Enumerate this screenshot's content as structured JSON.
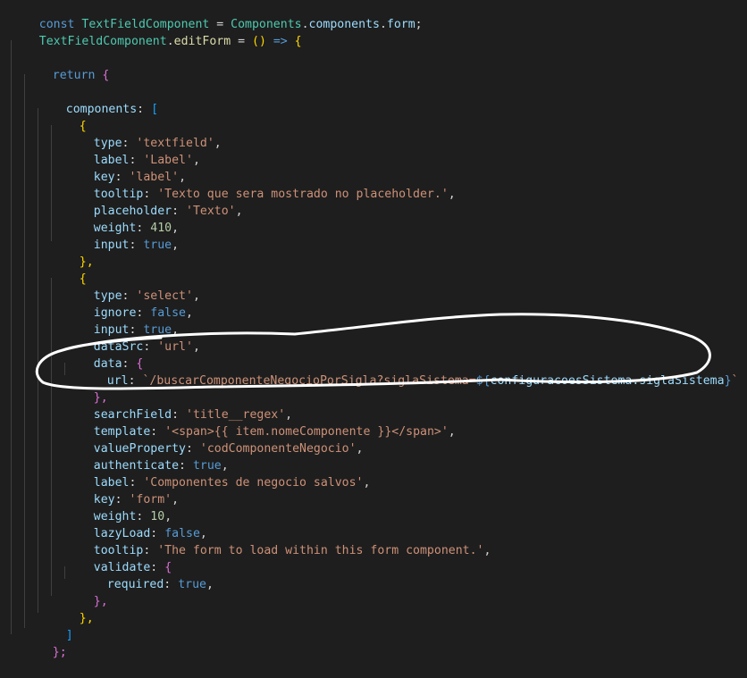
{
  "code": {
    "l1": {
      "kw": "const",
      "name": "TextFieldComponent",
      "eq": " = ",
      "obj": "Components",
      "dot1": ".",
      "p1": "components",
      "dot2": ".",
      "p2": "form",
      "semi": ";"
    },
    "l2": {
      "cls": "TextFieldComponent",
      "dot": ".",
      "fn": "editForm",
      "eq": " = ",
      "paren": "()",
      "arrow": " => ",
      "brace": "{"
    },
    "l4": {
      "kw": "return",
      "brace": "{"
    },
    "l6": {
      "key": "components",
      "colon": ": ",
      "bracket": "["
    },
    "obj_open": "{",
    "obj_close": "},",
    "comma": ",",
    "colon": ": ",
    "textfield": {
      "type_key": "type",
      "type_val": "'textfield'",
      "label_key": "label",
      "label_val": "'Label'",
      "key_key": "key",
      "key_val": "'label'",
      "tooltip_key": "tooltip",
      "tooltip_val": "'Texto que sera mostrado no placeholder.'",
      "placeholder_key": "placeholder",
      "placeholder_val": "'Texto'",
      "weight_key": "weight",
      "weight_val": "410",
      "input_key": "input",
      "input_val": "true"
    },
    "select": {
      "type_key": "type",
      "type_val": "'select'",
      "ignore_key": "ignore",
      "ignore_val": "false",
      "input_key": "input",
      "input_val": "true",
      "datasrc_key": "dataSrc",
      "datasrc_val": "'url'",
      "data_key": "data",
      "data_open": "{",
      "url_key": "url",
      "url_str": "`/buscarComponenteNegocioPorSigla?siglaSistema=",
      "url_tpl_open": "${",
      "url_tpl_var": "configuracoesSistema.siglaSistema",
      "url_tpl_close": "}",
      "url_end": "`",
      "data_close": "},",
      "searchfield_key": "searchField",
      "searchfield_val": "'title__regex'",
      "template_key": "template",
      "template_val": "'<span>{{ item.nomeComponente }}</span>'",
      "valueprop_key": "valueProperty",
      "valueprop_val": "'codComponenteNegocio'",
      "auth_key": "authenticate",
      "auth_val": "true",
      "label_key": "label",
      "label_val": "'Componentes de negocio salvos'",
      "key_key": "key",
      "key_val": "'form'",
      "weight_key": "weight",
      "weight_val": "10",
      "lazy_key": "lazyLoad",
      "lazy_val": "false",
      "tooltip_key": "tooltip",
      "tooltip_val": "'The form to load within this form component.'",
      "validate_key": "validate",
      "validate_open": "{",
      "required_key": "required",
      "required_val": "true",
      "validate_close": "},"
    },
    "arr_close": "]",
    "fn_close": "};"
  }
}
